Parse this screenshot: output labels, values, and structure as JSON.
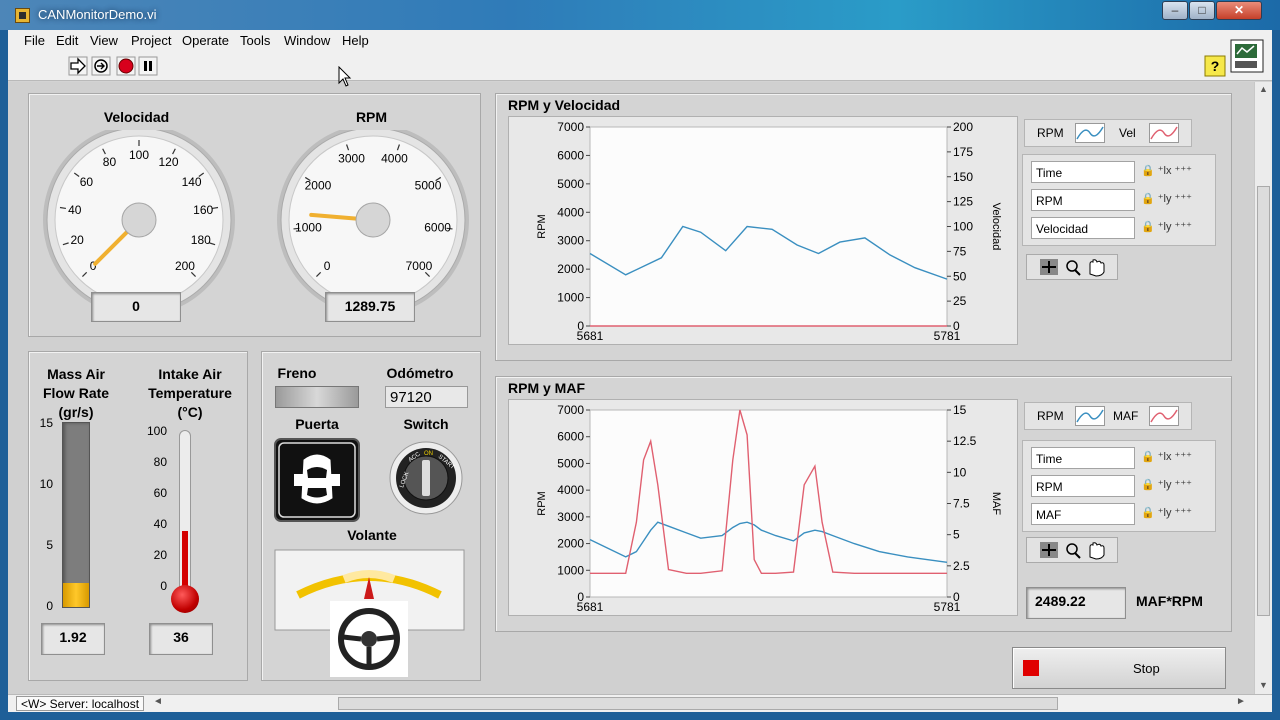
{
  "window": {
    "title": "CANMonitorDemo.vi",
    "min": "–",
    "max": "□",
    "close": "✕"
  },
  "menu": [
    "File",
    "Edit",
    "View",
    "Project",
    "Operate",
    "Tools",
    "Window",
    "Help"
  ],
  "toolbar": {
    "icons": [
      "run-arrow-icon",
      "run-continuously-icon",
      "abort-icon",
      "pause-icon",
      "help-icon",
      "vi-icon"
    ]
  },
  "gauges": {
    "velocidad": {
      "label": "Velocidad",
      "value": "0",
      "min": 0,
      "max": 200,
      "current": 0,
      "ticks": [
        "0",
        "20",
        "40",
        "60",
        "80",
        "100",
        "120",
        "140",
        "160",
        "180",
        "200"
      ]
    },
    "rpm": {
      "label": "RPM",
      "value": "1289.75",
      "min": 0,
      "max": 7000,
      "current": 1289.75,
      "ticks": [
        "0",
        "1000",
        "2000",
        "3000",
        "4000",
        "5000",
        "6000",
        "7000"
      ]
    }
  },
  "maf": {
    "label_lines": [
      "Mass Air",
      "Flow Rate",
      "(gr/s)"
    ],
    "ticks": [
      "15",
      "10",
      "5",
      "0"
    ],
    "value": "1.92",
    "fill_fraction": 0.128,
    "fill_color": "#f0b400"
  },
  "iat": {
    "label_lines": [
      "Intake Air",
      "Temperature",
      "(°C)"
    ],
    "ticks": [
      "100",
      "80",
      "60",
      "40",
      "20",
      "0"
    ],
    "value": "36",
    "fill_fraction": 0.36,
    "fill_color": "#d40000"
  },
  "car": {
    "freno": "Freno",
    "odometro_label": "Odómetro",
    "odometro_value": "97120",
    "puerta": "Puerta",
    "switch": "Switch",
    "volante": "Volante",
    "switch_labels": [
      "LOCK",
      "ACC",
      "ON",
      "START"
    ]
  },
  "chart1": {
    "title": "RPM y Velocidad",
    "legend": [
      "RPM",
      "Vel"
    ],
    "cursor_rows": [
      "Time",
      "RPM",
      "Velocidad"
    ],
    "y_ticks": [
      "7000",
      "6000",
      "5000",
      "4000",
      "3000",
      "2000",
      "1000",
      "0"
    ],
    "y2_ticks": [
      "200",
      "175",
      "150",
      "125",
      "100",
      "75",
      "50",
      "25",
      "0"
    ],
    "x_ticks": [
      "5681",
      "5781"
    ],
    "ylabel": "RPM",
    "y2label": "Velocidad"
  },
  "chart2": {
    "title": "RPM y MAF",
    "legend": [
      "RPM",
      "MAF"
    ],
    "cursor_rows": [
      "Time",
      "RPM",
      "MAF"
    ],
    "y_ticks": [
      "7000",
      "6000",
      "5000",
      "4000",
      "3000",
      "2000",
      "1000",
      "0"
    ],
    "y2_ticks": [
      "15",
      "12.5",
      "10",
      "7.5",
      "5",
      "2.5",
      "0"
    ],
    "x_ticks": [
      "5681",
      "5781"
    ],
    "ylabel": "RPM",
    "y2label": "MAF"
  },
  "maf_rpm": {
    "value": "2489.22",
    "label": "MAF*RPM"
  },
  "stop": {
    "label": "Stop"
  },
  "status": {
    "server": "<W> Server: localhost"
  },
  "chart_data": [
    {
      "type": "line",
      "title": "RPM y Velocidad",
      "xlabel": "",
      "ylabel": "RPM",
      "y2label": "Velocidad",
      "xlim": [
        5681,
        5781
      ],
      "ylim": [
        0,
        7000
      ],
      "y2lim": [
        0,
        200
      ],
      "x": [
        5681,
        5691,
        5701,
        5707,
        5712,
        5719,
        5725,
        5732,
        5739,
        5745,
        5751,
        5758,
        5765,
        5772,
        5781
      ],
      "series": [
        {
          "name": "RPM",
          "color": "#3a8fc0",
          "axis": "left",
          "values": [
            2550,
            1800,
            2400,
            3500,
            3300,
            2650,
            3500,
            3400,
            2850,
            2550,
            2950,
            3100,
            2500,
            2050,
            1650
          ]
        },
        {
          "name": "Vel",
          "color": "#e06070",
          "axis": "right",
          "values": [
            0,
            0,
            0,
            0,
            0,
            0,
            0,
            0,
            0,
            0,
            0,
            0,
            0,
            0,
            0
          ]
        }
      ]
    },
    {
      "type": "line",
      "title": "RPM y MAF",
      "xlabel": "",
      "ylabel": "RPM",
      "y2label": "MAF",
      "xlim": [
        5681,
        5781
      ],
      "ylim": [
        0,
        7000
      ],
      "y2lim": [
        0,
        15
      ],
      "x": [
        5681,
        5691,
        5694,
        5696,
        5698,
        5700,
        5703,
        5708,
        5712,
        5718,
        5721,
        5723,
        5725,
        5727,
        5729,
        5733,
        5738,
        5741,
        5744,
        5746,
        5749,
        5755,
        5762,
        5770,
        5781
      ],
      "series": [
        {
          "name": "RPM",
          "color": "#3a8fc0",
          "axis": "left",
          "values": [
            2150,
            1500,
            1700,
            2100,
            2500,
            2800,
            2650,
            2400,
            2200,
            2300,
            2600,
            2750,
            2800,
            2700,
            2500,
            2300,
            2100,
            2400,
            2500,
            2450,
            2300,
            2000,
            1700,
            1500,
            1300
          ]
        },
        {
          "name": "MAF",
          "color": "#e06070",
          "axis": "right",
          "values": [
            1.9,
            1.9,
            6,
            11,
            12.5,
            9,
            2.2,
            1.9,
            1.9,
            2.1,
            11,
            15,
            13,
            3,
            1.9,
            1.9,
            2,
            9,
            10.5,
            6,
            2,
            1.9,
            1.9,
            1.9,
            1.9
          ]
        }
      ]
    }
  ]
}
